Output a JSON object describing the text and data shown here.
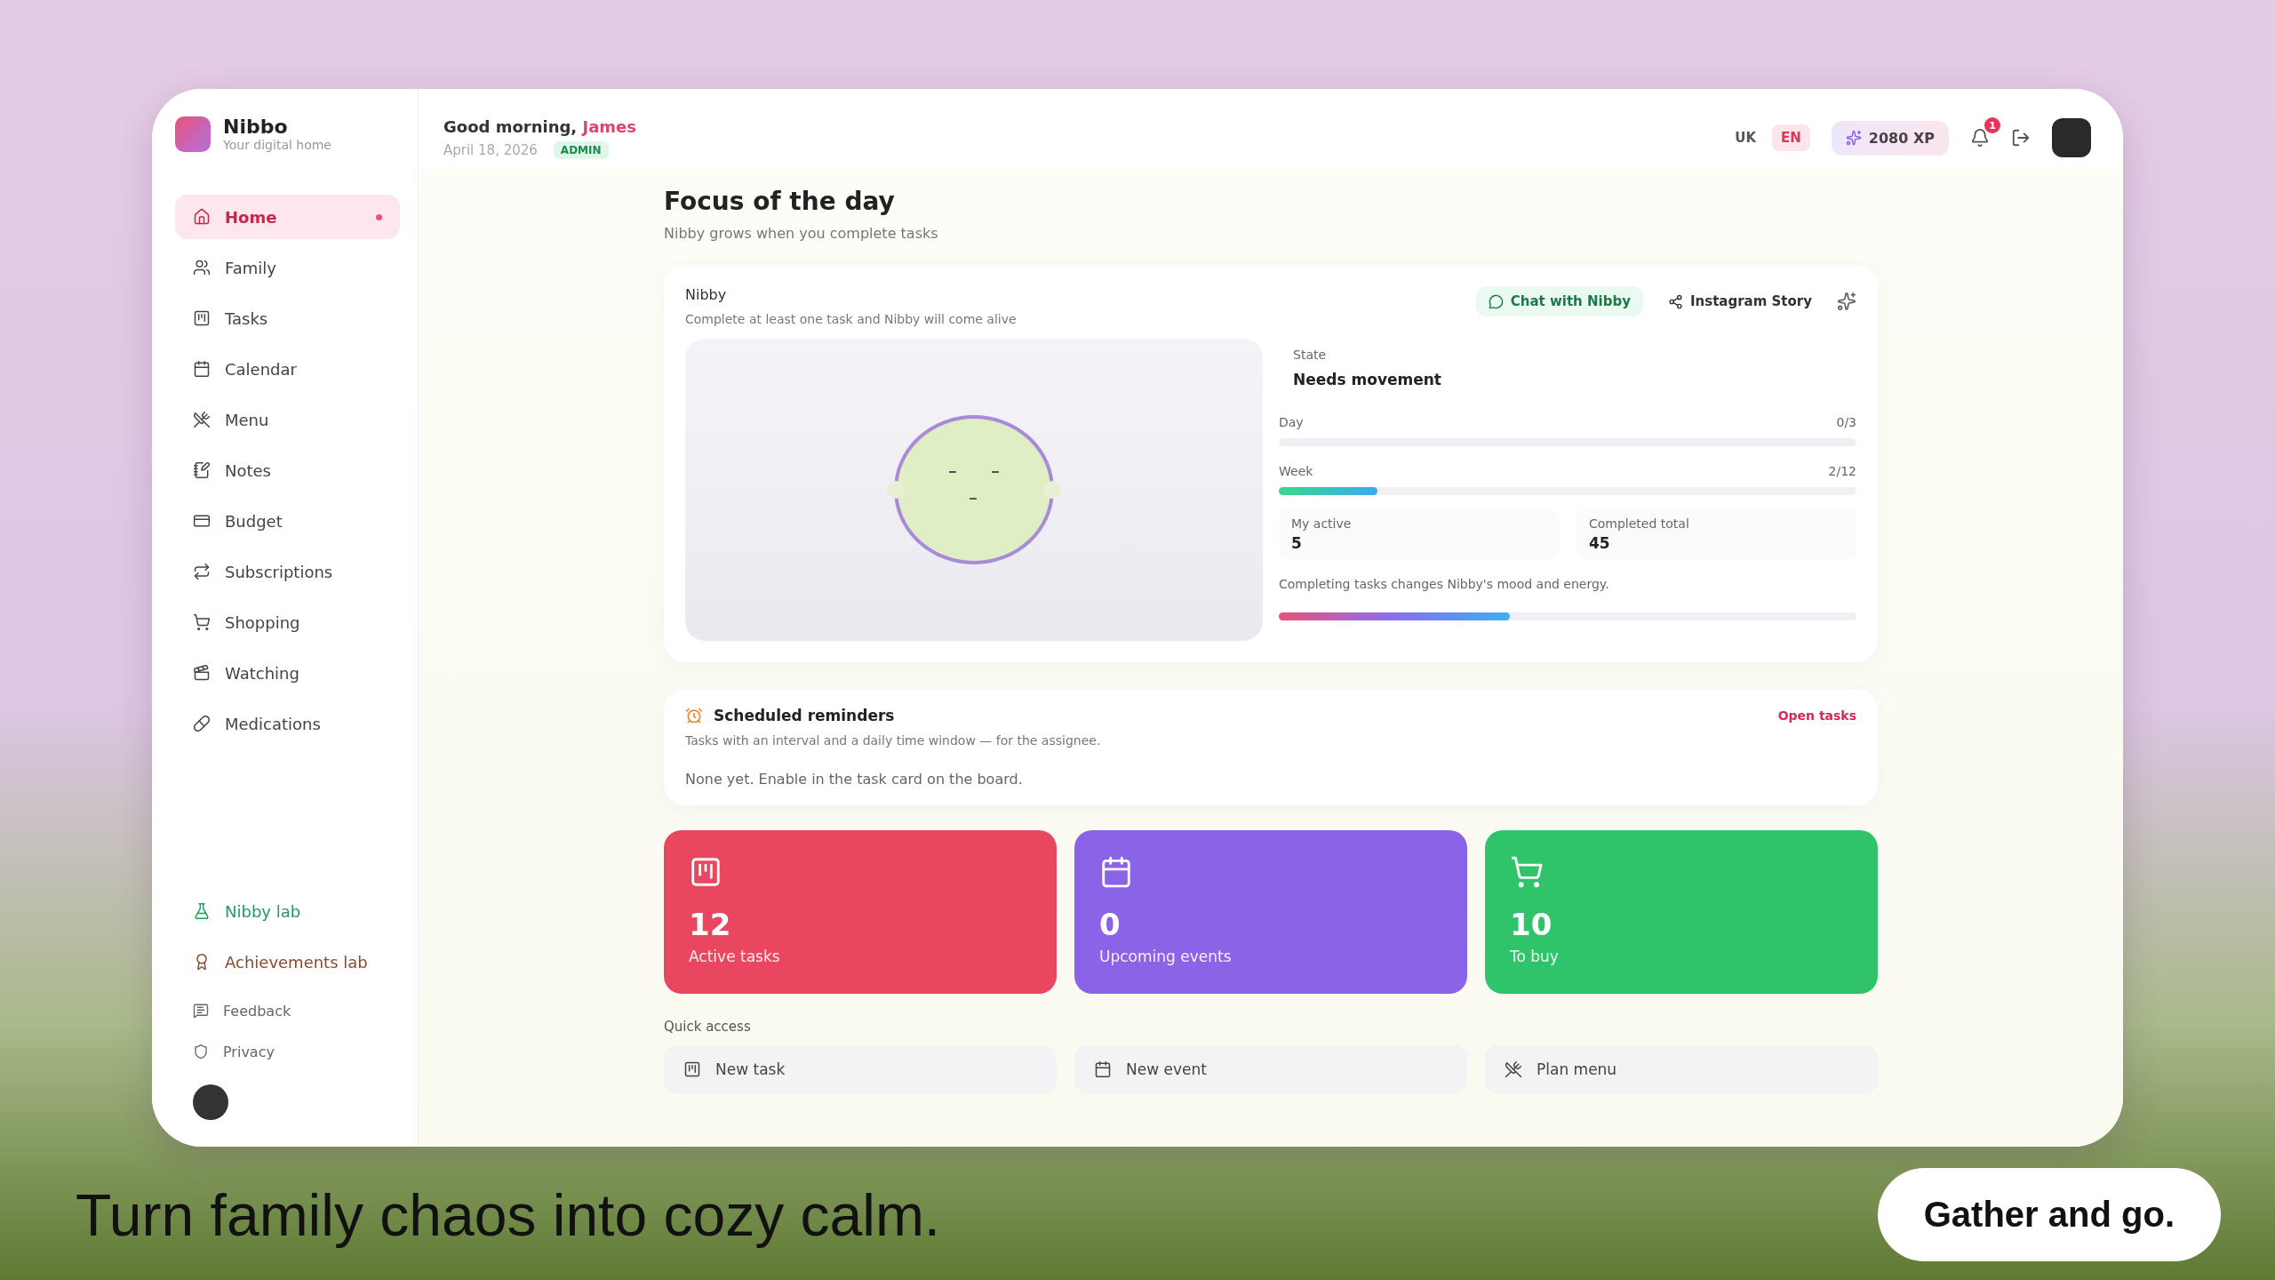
{
  "brand": {
    "name": "Nibbo",
    "tagline": "Your digital home"
  },
  "sidebar": {
    "items": [
      {
        "label": "Home",
        "selected": true,
        "unread": true
      },
      {
        "label": "Family",
        "selected": false,
        "unread": false
      },
      {
        "label": "Tasks",
        "selected": false,
        "unread": false
      },
      {
        "label": "Calendar",
        "selected": false,
        "unread": false
      },
      {
        "label": "Menu",
        "selected": false,
        "unread": false
      },
      {
        "label": "Notes",
        "selected": false,
        "unread": false
      },
      {
        "label": "Budget",
        "selected": false,
        "unread": false
      },
      {
        "label": "Subscriptions",
        "selected": false,
        "unread": false
      },
      {
        "label": "Shopping",
        "selected": false,
        "unread": false
      },
      {
        "label": "Watching",
        "selected": false,
        "unread": false
      },
      {
        "label": "Medications",
        "selected": false,
        "unread": false
      }
    ],
    "labs": [
      {
        "label": "Nibby lab",
        "color": "#1f9d5c"
      },
      {
        "label": "Achievements lab",
        "color": "#8a4a2e"
      }
    ],
    "footer_links": [
      "Feedback",
      "Privacy"
    ]
  },
  "header": {
    "greeting": "Good morning,",
    "name": "James",
    "date": "April 18, 2026",
    "role": "ADMIN",
    "languages": [
      {
        "label": "UK",
        "selected": false
      },
      {
        "label": "EN",
        "selected": true
      }
    ],
    "xp": "2080 XP",
    "notifications": "1"
  },
  "focus": {
    "title": "Focus of the day",
    "subtitle": "Nibby grows when you complete tasks"
  },
  "nibby": {
    "title": "Nibby",
    "subtitle": "Complete at least one task and Nibby will come alive",
    "actions": [
      "Chat with Nibby",
      "Instagram Story"
    ],
    "state_label": "State",
    "state": "Needs movement",
    "progress": [
      {
        "label": "Day",
        "reading": "0/3",
        "level": 0
      },
      {
        "label": "Week",
        "reading": "2/12",
        "level": 0.17
      }
    ],
    "stats": [
      {
        "label": "My active",
        "value": "5"
      },
      {
        "label": "Completed total",
        "value": "45"
      }
    ],
    "note": "Completing tasks changes Nibby's mood and energy.",
    "mood": {
      "level": 0.4
    }
  },
  "reminders": {
    "title": "Scheduled reminders",
    "subtitle": "Tasks with an interval and a daily time window — for the assignee.",
    "link": "Open tasks",
    "empty": "None yet. Enable in the task card on the board."
  },
  "stat_cards": [
    {
      "value": "12",
      "label": "Active tasks",
      "color": "#e8475f"
    },
    {
      "value": "0",
      "label": "Upcoming events",
      "color": "#8a63e6"
    },
    {
      "value": "10",
      "label": "To buy",
      "color": "#2fc46a"
    }
  ],
  "quick_access": {
    "title": "Quick access",
    "items": [
      "New task",
      "New event",
      "Plan menu"
    ]
  },
  "caption": "Turn family chaos into cozy calm.",
  "pill": "Gather and go."
}
